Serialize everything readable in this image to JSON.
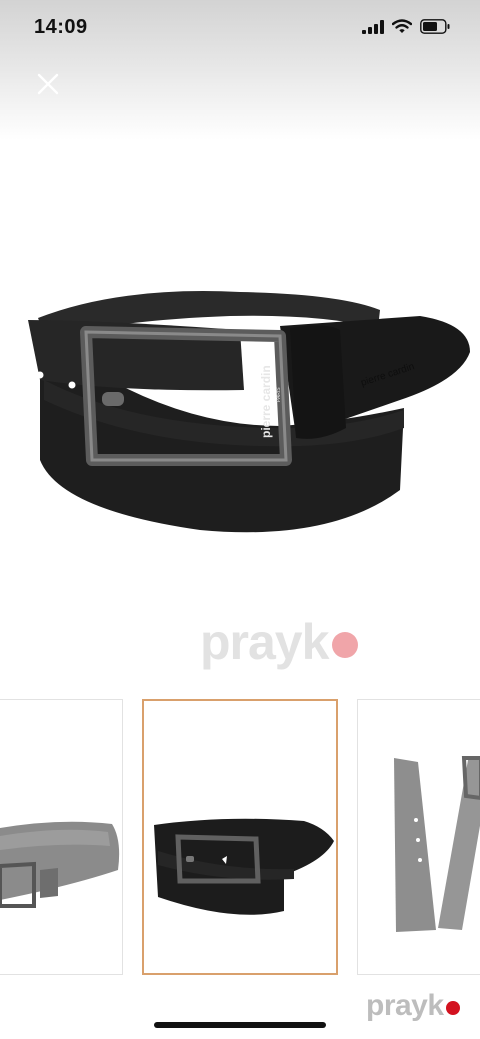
{
  "status_bar": {
    "time": "14:09",
    "icons": [
      "cellular-signal-icon",
      "wifi-icon",
      "battery-icon"
    ]
  },
  "header": {
    "close_icon": "close-icon"
  },
  "main_image": {
    "alt": "Black leather belt with silver buckle",
    "engraving": "pierre cardin",
    "engraving_sub": "PARIS"
  },
  "watermark": {
    "text": "prayk",
    "dot_color": "#f0a5a9"
  },
  "thumbnails": {
    "selected_index": 1,
    "items": [
      {
        "color": "grey"
      },
      {
        "color": "black"
      },
      {
        "color": "grey"
      }
    ]
  },
  "corner_watermark": {
    "text": "prayk",
    "dot_color": "#d3121f"
  },
  "colors": {
    "selected_border": "#d9a06c",
    "thumb_border": "#e2e2e2"
  }
}
